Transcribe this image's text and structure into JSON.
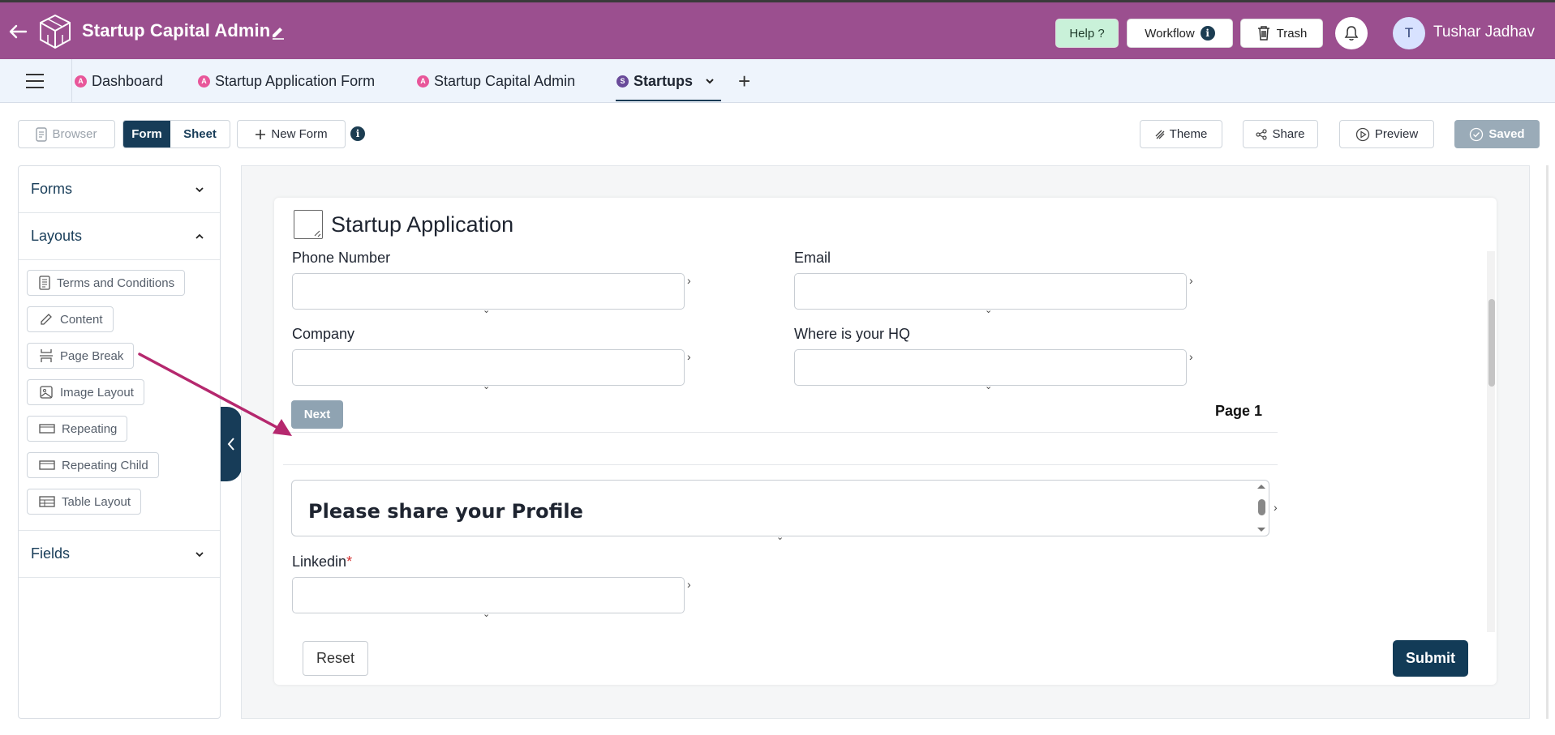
{
  "header": {
    "title": "Startup Capital Admin",
    "help_label": "Help ?",
    "workflow_label": "Workflow",
    "trash_label": "Trash",
    "user_initial": "T",
    "user_name": "Tushar Jadhav",
    "background_color": "#9b4f8f"
  },
  "tabs": [
    {
      "label": "Dashboard",
      "badge": "A"
    },
    {
      "label": "Startup Application Form",
      "badge": "A"
    },
    {
      "label": "Startup Capital Admin",
      "badge": "A"
    },
    {
      "label": "Startups",
      "badge": "S",
      "active": true
    }
  ],
  "toolbar": {
    "browser_label": "Browser",
    "form_label": "Form",
    "sheet_label": "Sheet",
    "new_form_label": "New Form",
    "theme_label": "Theme",
    "share_label": "Share",
    "preview_label": "Preview",
    "saved_label": "Saved"
  },
  "left_panel": {
    "forms_label": "Forms",
    "layouts_label": "Layouts",
    "fields_label": "Fields",
    "layout_items": [
      {
        "label": "Terms and Conditions",
        "icon": "document-icon"
      },
      {
        "label": "Content",
        "icon": "pencil-icon"
      },
      {
        "label": "Page Break",
        "icon": "page-break-icon"
      },
      {
        "label": "Image Layout",
        "icon": "image-icon"
      },
      {
        "label": "Repeating",
        "icon": "repeating-icon"
      },
      {
        "label": "Repeating Child",
        "icon": "repeating-child-icon"
      },
      {
        "label": "Table Layout",
        "icon": "table-icon"
      }
    ]
  },
  "form": {
    "title": "Startup Application",
    "fields": {
      "phone_label": "Phone Number",
      "email_label": "Email",
      "company_label": "Company",
      "hq_label": "Where is your HQ",
      "linkedin_label": "Linkedin",
      "required_mark": "*"
    },
    "next_label": "Next",
    "page_label": "Page 1",
    "profile_heading": "Please share your Profile",
    "reset_label": "Reset",
    "submit_label": "Submit"
  },
  "colors": {
    "accent_dark": "#173c58",
    "arrow": "#b5286e"
  }
}
